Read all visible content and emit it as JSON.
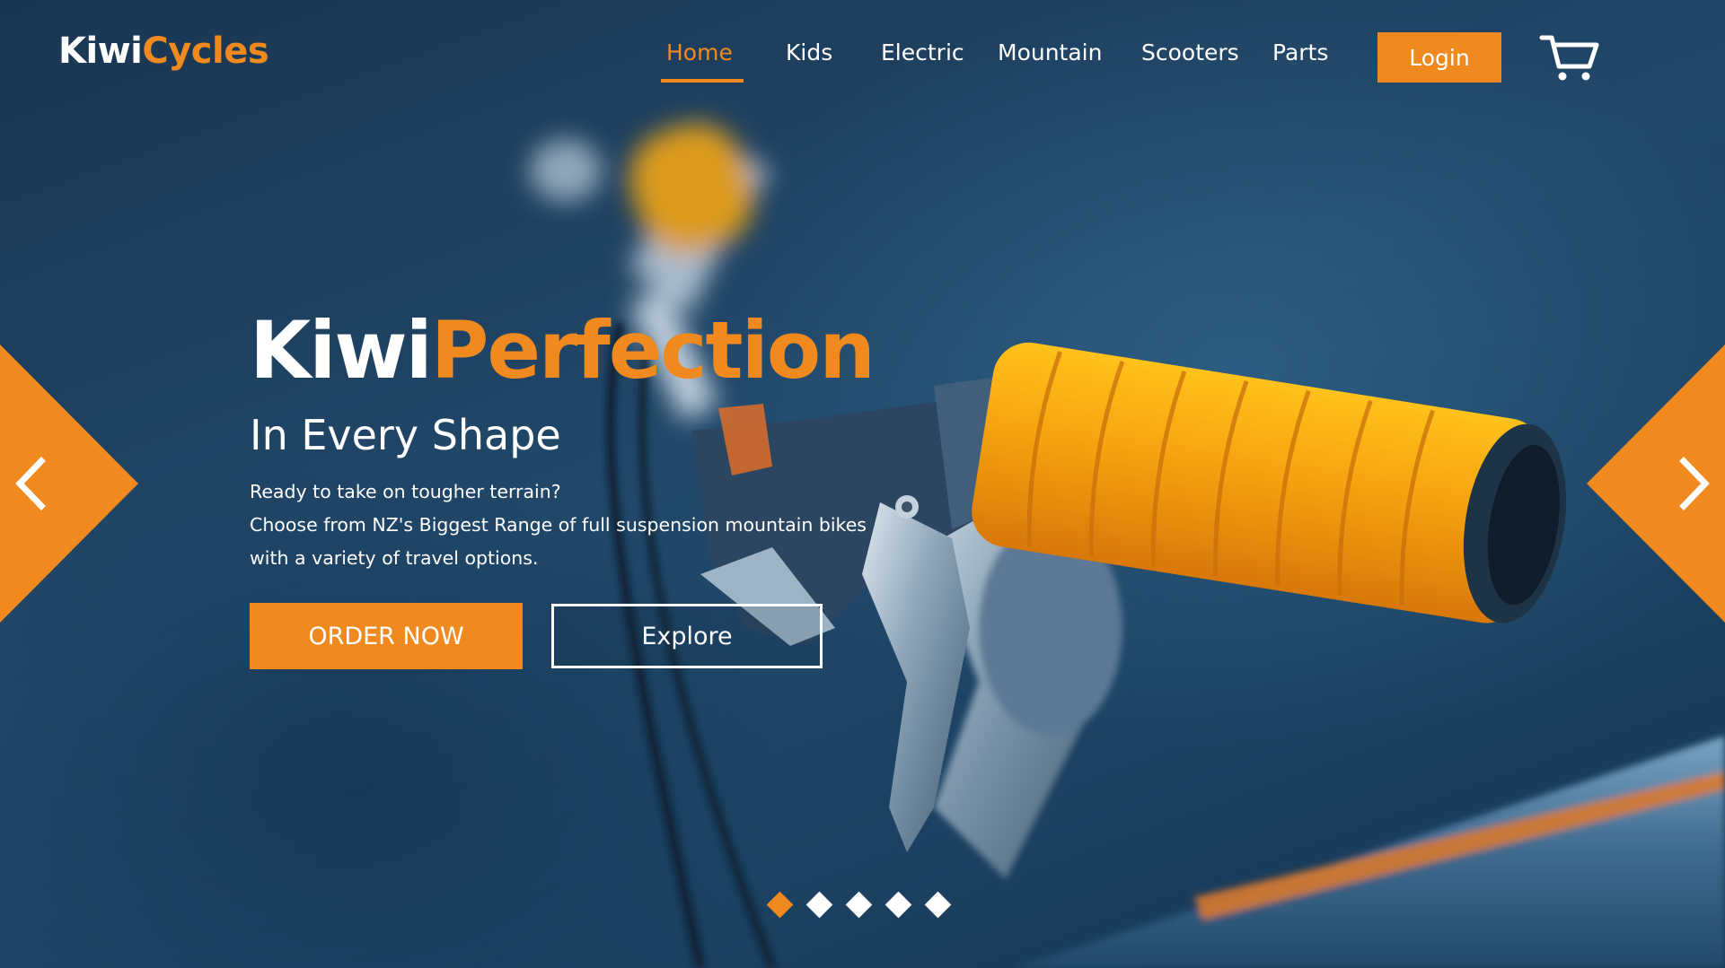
{
  "header": {
    "logo_primary": "Kiwi",
    "logo_accent": "Cycles",
    "nav": [
      {
        "label": "Home",
        "active": true
      },
      {
        "label": "Kids",
        "active": false
      },
      {
        "label": "Electric",
        "active": false
      },
      {
        "label": "Mountain",
        "active": false
      },
      {
        "label": "Scooters",
        "active": false
      },
      {
        "label": "Parts",
        "active": false
      }
    ],
    "login_label": "Login",
    "cart_icon": "shopping-cart-icon"
  },
  "hero": {
    "title_primary": "Kiwi",
    "title_accent": "Perfection",
    "subtitle": "In Every Shape",
    "body_lines": [
      "Ready to take on tougher terrain?",
      "Choose from NZ's Biggest Range of full suspension mountain bikes",
      "with a variety of travel options."
    ],
    "primary_button": "ORDER NOW",
    "secondary_button": "Explore"
  },
  "slider": {
    "prev_icon": "chevron-left-icon",
    "next_icon": "chevron-right-icon",
    "slide_count": 5,
    "active_slide": 1
  },
  "colors": {
    "accent": "#f08a1e",
    "background": "#1d3f5c",
    "text": "#ffffff"
  }
}
